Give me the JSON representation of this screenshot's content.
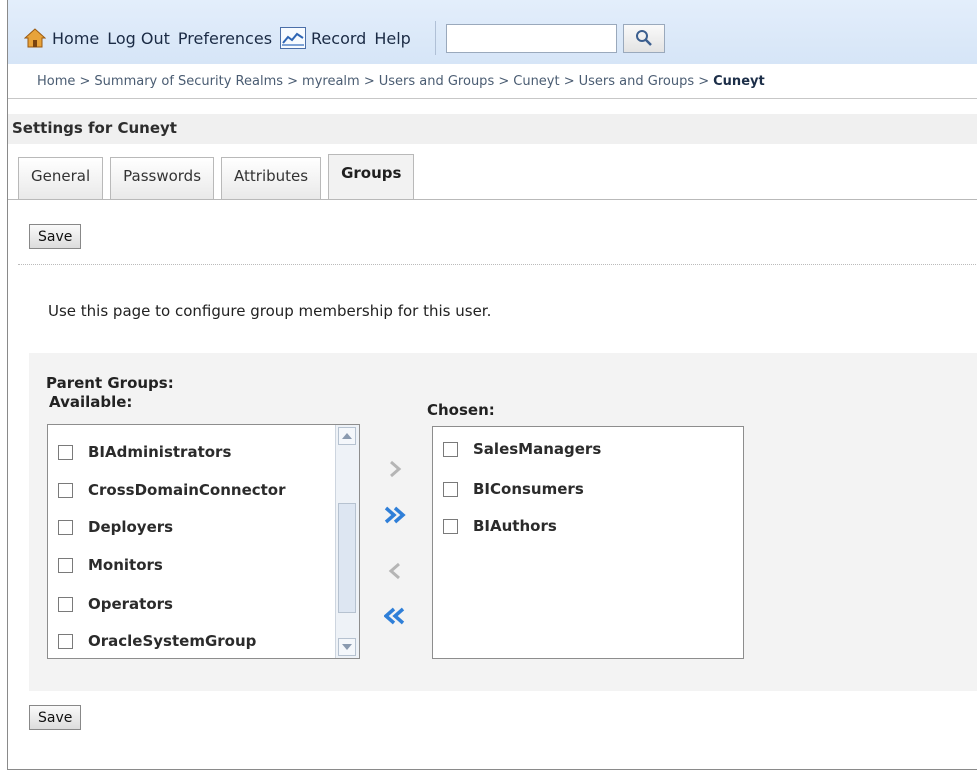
{
  "nav": {
    "home": "Home",
    "logout": "Log Out",
    "preferences": "Preferences",
    "record": "Record",
    "help": "Help",
    "search_value": "",
    "home_icon": "home-icon",
    "record_icon": "record-icon",
    "search_icon": "magnifier-icon"
  },
  "breadcrumb": {
    "items": [
      "Home >",
      "Summary of Security Realms >",
      "myrealm >",
      "Users and Groups >",
      "Cuneyt >",
      "Users and Groups >"
    ],
    "current": "Cuneyt"
  },
  "settings_title": "Settings for Cuneyt",
  "tabs": [
    "General",
    "Passwords",
    "Attributes",
    "Groups"
  ],
  "active_tab": "Groups",
  "save_label": "Save",
  "intro_text": "Use this page to configure group membership for this user.",
  "parent_groups_label": "Parent Groups:",
  "available_label": "Available:",
  "chosen_label": "Chosen:",
  "available": [
    "BIAdministrators",
    "CrossDomainConnector",
    "Deployers",
    "Monitors",
    "Operators",
    "OracleSystemGroup"
  ],
  "chosen": [
    "SalesManagers",
    "BIConsumers",
    "BIAuthors"
  ],
  "shuttle_buttons": {
    "move": "move-right-icon",
    "move_all": "move-all-right-icon",
    "remove": "move-left-icon",
    "remove_all": "move-all-left-icon"
  },
  "colors": {
    "nav_background": "#d6e5f7",
    "shuttle_active": "#2f7fd8",
    "shuttle_disabled": "#b5b5b5"
  }
}
